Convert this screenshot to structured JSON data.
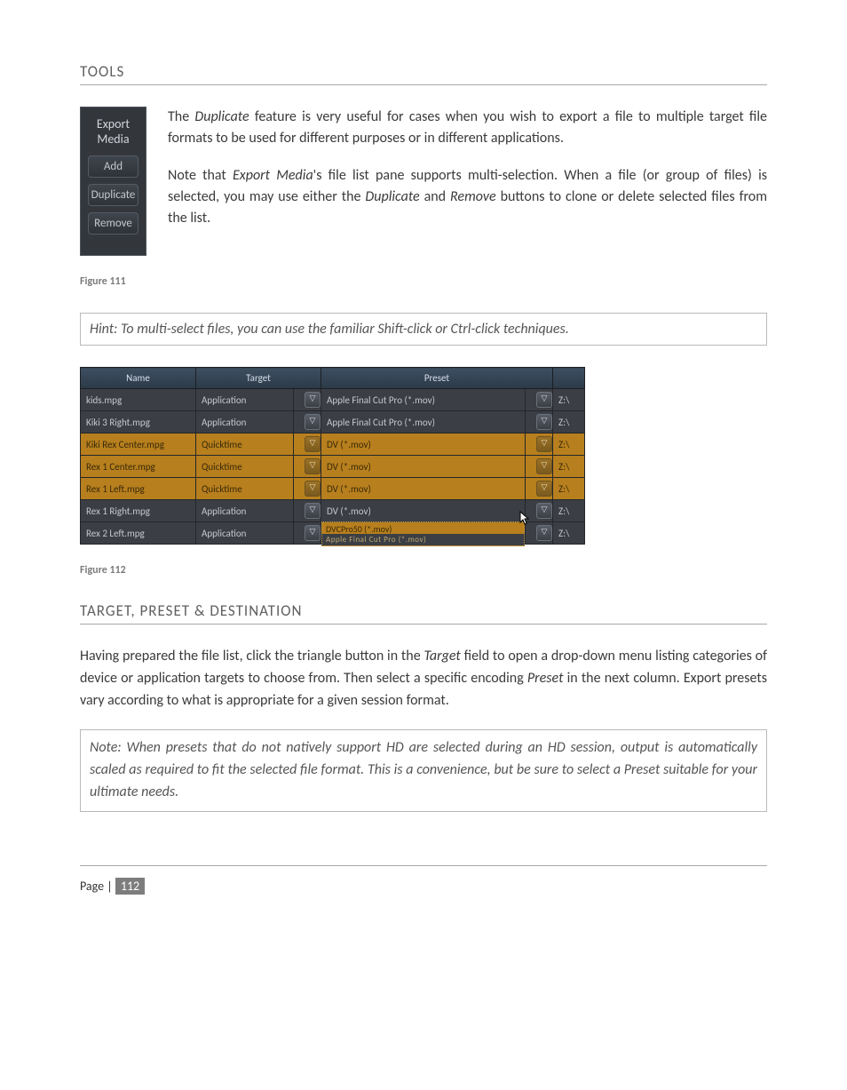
{
  "section1": {
    "heading": "TOOLS"
  },
  "panel": {
    "title": "Export Media",
    "add": "Add",
    "duplicate": "Duplicate",
    "remove": "Remove"
  },
  "tools_text": {
    "p1_a": "The ",
    "p1_term": "Duplicate",
    "p1_b": " feature is very useful for cases when you wish to export a file to multiple target file formats to be used for different purposes or in different applications.",
    "p2_a": "Note that ",
    "p2_term": "Export Media",
    "p2_b": "'s file list pane supports multi-selection.  When a file (or group of files) is selected, you may use either the ",
    "p2_term2": "Duplicate",
    "p2_c": " and ",
    "p2_term3": "Remove",
    "p2_d": " buttons to clone or delete selected files from the list."
  },
  "fig111": "Figure 111",
  "hint": "Hint: To multi-select files, you can use the familiar Shift-click or Ctrl-click techniques.",
  "table": {
    "headers": {
      "name": "Name",
      "target": "Target",
      "preset": "Preset"
    },
    "rows": [
      {
        "name": "kids.mpg",
        "target": "Application",
        "preset": "Apple Final Cut Pro (*.mov)",
        "dest": "Z:\\",
        "selected": false
      },
      {
        "name": "Kiki 3 Right.mpg",
        "target": "Application",
        "preset": "Apple Final Cut Pro (*.mov)",
        "dest": "Z:\\",
        "selected": false
      },
      {
        "name": "Kiki Rex Center.mpg",
        "target": "Quicktime",
        "preset": "DV (*.mov)",
        "dest": "Z:\\",
        "selected": true
      },
      {
        "name": "Rex 1 Center.mpg",
        "target": "Quicktime",
        "preset": "DV (*.mov)",
        "dest": "Z:\\",
        "selected": true
      },
      {
        "name": "Rex 1 Left.mpg",
        "target": "Quicktime",
        "preset": "DV (*.mov)",
        "dest": "Z:\\",
        "selected": true
      },
      {
        "name": "Rex 1 Right.mpg",
        "target": "Application",
        "preset": "",
        "dest": "Z:\\",
        "selected": false
      },
      {
        "name": "Rex 2 Left.mpg",
        "target": "Application",
        "preset": "",
        "dest": "Z:\\",
        "selected": false
      }
    ],
    "dropdown": {
      "open_row_index": 5,
      "item1": "DVCPro50 (*.mov)",
      "item2": "Apple Final Cut Pro (*.mov)",
      "prev_visible": "DV (*.mov)"
    }
  },
  "fig112": "Figure 112",
  "section2": {
    "heading": "TARGET, PRESET & DESTINATION"
  },
  "body2": {
    "p1_a": "Having prepared the file list, click the triangle button in the ",
    "p1_term": "Target",
    "p1_b": " field to open a drop-down menu listing categories of device or application targets to choose from.  Then select a specific encoding ",
    "p1_term2": "Preset",
    "p1_c": " in the next column. Export presets vary according to what is appropriate for a given session format."
  },
  "note": "Note: When presets that do not natively support HD are selected during an HD session, output is automatically scaled as required to fit the selected file format.  This is a convenience, but be sure to select a Preset suitable for your ultimate needs.",
  "footer": {
    "label": "Page | ",
    "number": "112"
  }
}
